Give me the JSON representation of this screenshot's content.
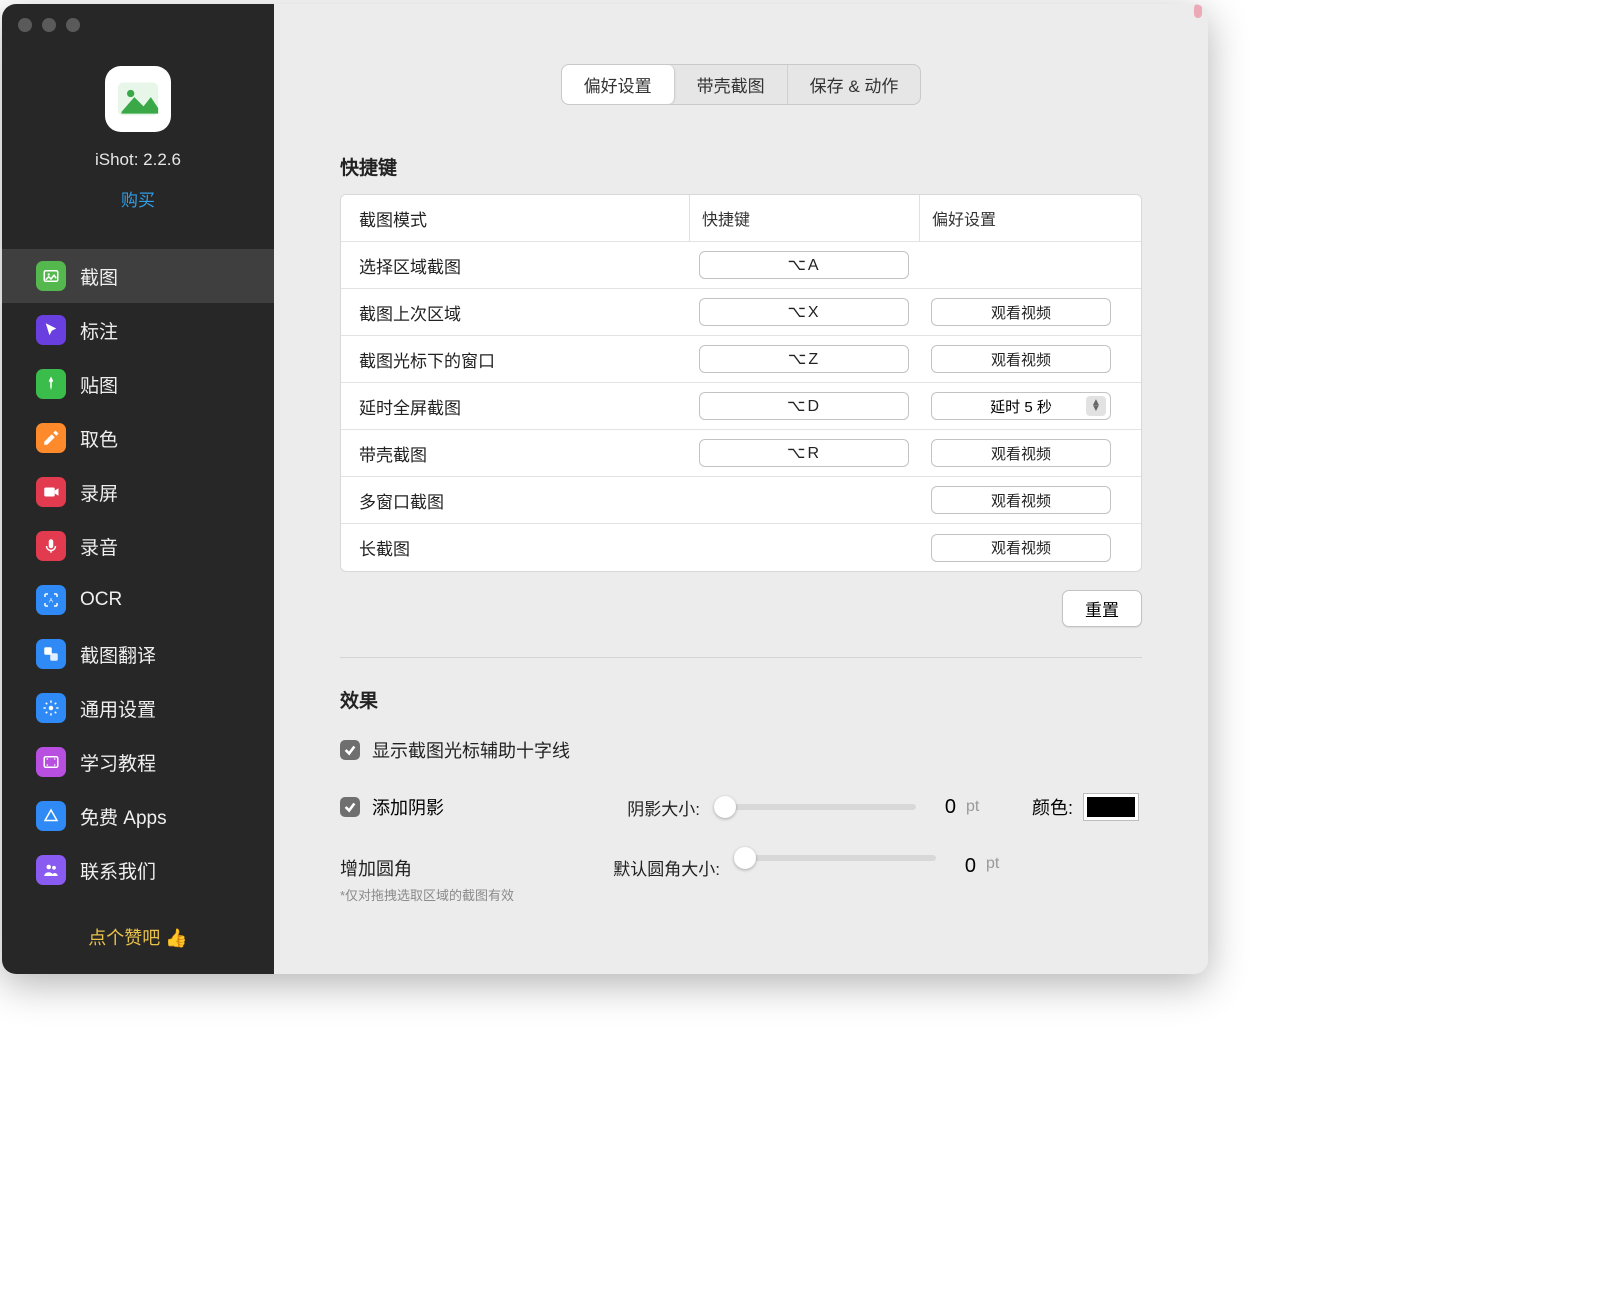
{
  "app": {
    "title": "iShot: 2.2.6",
    "buy": "购买",
    "like_prompt": "点个赞吧 👍"
  },
  "sidebar": {
    "items": [
      {
        "label": "截图",
        "color": "#55b84e",
        "icon": "image"
      },
      {
        "label": "标注",
        "color": "#6a3fe0",
        "icon": "cursor"
      },
      {
        "label": "贴图",
        "color": "#3bbd4b",
        "icon": "pin"
      },
      {
        "label": "取色",
        "color": "#ff8a2c",
        "icon": "dropper"
      },
      {
        "label": "录屏",
        "color": "#e23a4f",
        "icon": "record"
      },
      {
        "label": "录音",
        "color": "#e23a4f",
        "icon": "mic"
      },
      {
        "label": "OCR",
        "color": "#2f8af5",
        "icon": "ocr"
      },
      {
        "label": "截图翻译",
        "color": "#2f8af5",
        "icon": "translate"
      },
      {
        "label": "通用设置",
        "color": "#2f8af5",
        "icon": "gear"
      },
      {
        "label": "学习教程",
        "color": "#b94fe0",
        "icon": "film"
      },
      {
        "label": "免费 Apps",
        "color": "#2f8af5",
        "icon": "appstore"
      },
      {
        "label": "联系我们",
        "color": "#8a5bf0",
        "icon": "people"
      }
    ]
  },
  "tabs": {
    "items": [
      "偏好设置",
      "带壳截图",
      "保存 & 动作"
    ],
    "active": 0
  },
  "shortcuts": {
    "title": "快捷键",
    "headers": {
      "mode": "截图模式",
      "key": "快捷键",
      "pref": "偏好设置"
    },
    "watch_video": "观看视频",
    "delay_option": "延时 5 秒",
    "reset": "重置",
    "rows": [
      {
        "mode": "选择区域截图",
        "key": "⌥A",
        "pref": ""
      },
      {
        "mode": "截图上次区域",
        "key": "⌥X",
        "pref": "video"
      },
      {
        "mode": "截图光标下的窗口",
        "key": "⌥Z",
        "pref": "video"
      },
      {
        "mode": "延时全屏截图",
        "key": "⌥D",
        "pref": "delay"
      },
      {
        "mode": "带壳截图",
        "key": "⌥R",
        "pref": "video"
      },
      {
        "mode": "多窗口截图",
        "key": "",
        "pref": "video"
      },
      {
        "mode": "长截图",
        "key": "",
        "pref": "video"
      }
    ]
  },
  "effects": {
    "title": "效果",
    "crosshair": "显示截图光标辅助十字线",
    "shadow": "添加阴影",
    "shadow_size_label": "阴影大小:",
    "shadow_size_value": "0",
    "unit": "pt",
    "color_label": "颜色:",
    "color_value": "#000000",
    "rounded_title": "增加圆角",
    "rounded_note": "*仅对拖拽选取区域的截图有效",
    "rounded_size_label": "默认圆角大小:",
    "rounded_size_value": "0"
  }
}
